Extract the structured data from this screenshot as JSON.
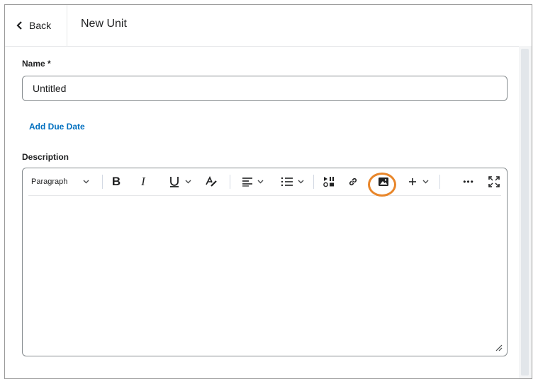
{
  "header": {
    "back_label": "Back",
    "title": "New Unit"
  },
  "form": {
    "name_label": "Name *",
    "name_value": "Untitled",
    "add_due_date": "Add Due Date",
    "description_label": "Description"
  },
  "toolbar": {
    "format_select": "Paragraph",
    "more_label": "•••"
  },
  "colors": {
    "accent_link": "#006fbf",
    "highlight_ring": "#e8862a"
  }
}
